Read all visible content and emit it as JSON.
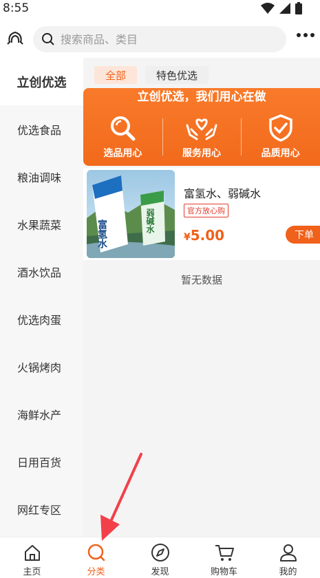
{
  "status": {
    "time": "8:55"
  },
  "header": {
    "search_placeholder": "搜索商品、类目"
  },
  "sidebar": {
    "items": [
      {
        "label": "立创优选",
        "active": true
      },
      {
        "label": "优选食品"
      },
      {
        "label": "粮油调味"
      },
      {
        "label": "水果蔬菜"
      },
      {
        "label": "酒水饮品"
      },
      {
        "label": "优选肉蛋"
      },
      {
        "label": "火锅烤肉"
      },
      {
        "label": "海鲜水产"
      },
      {
        "label": "日用百货"
      },
      {
        "label": "网红专区"
      }
    ]
  },
  "tabs": [
    {
      "label": "全部",
      "active": true
    },
    {
      "label": "特色优选"
    }
  ],
  "banner": {
    "title": "立创优选，我们用心在做",
    "items": [
      "选品用心",
      "服务用心",
      "品质用心"
    ]
  },
  "product": {
    "name": "富氢水、弱碱水",
    "tag": "官方放心购",
    "currency": "¥",
    "price": "5.00",
    "buy_label": "下单",
    "image_text_1": "富氢水",
    "image_text_2": "弱碱水"
  },
  "empty_text": "暂无数据",
  "tabbar": {
    "items": [
      {
        "label": "主页",
        "icon": "home-icon"
      },
      {
        "label": "分类",
        "icon": "search-icon",
        "active": true
      },
      {
        "label": "发现",
        "icon": "compass-icon"
      },
      {
        "label": "购物车",
        "icon": "cart-icon"
      },
      {
        "label": "我的",
        "icon": "user-icon"
      }
    ]
  },
  "colors": {
    "accent": "#f0611b",
    "tag_red": "#e23b2b"
  }
}
